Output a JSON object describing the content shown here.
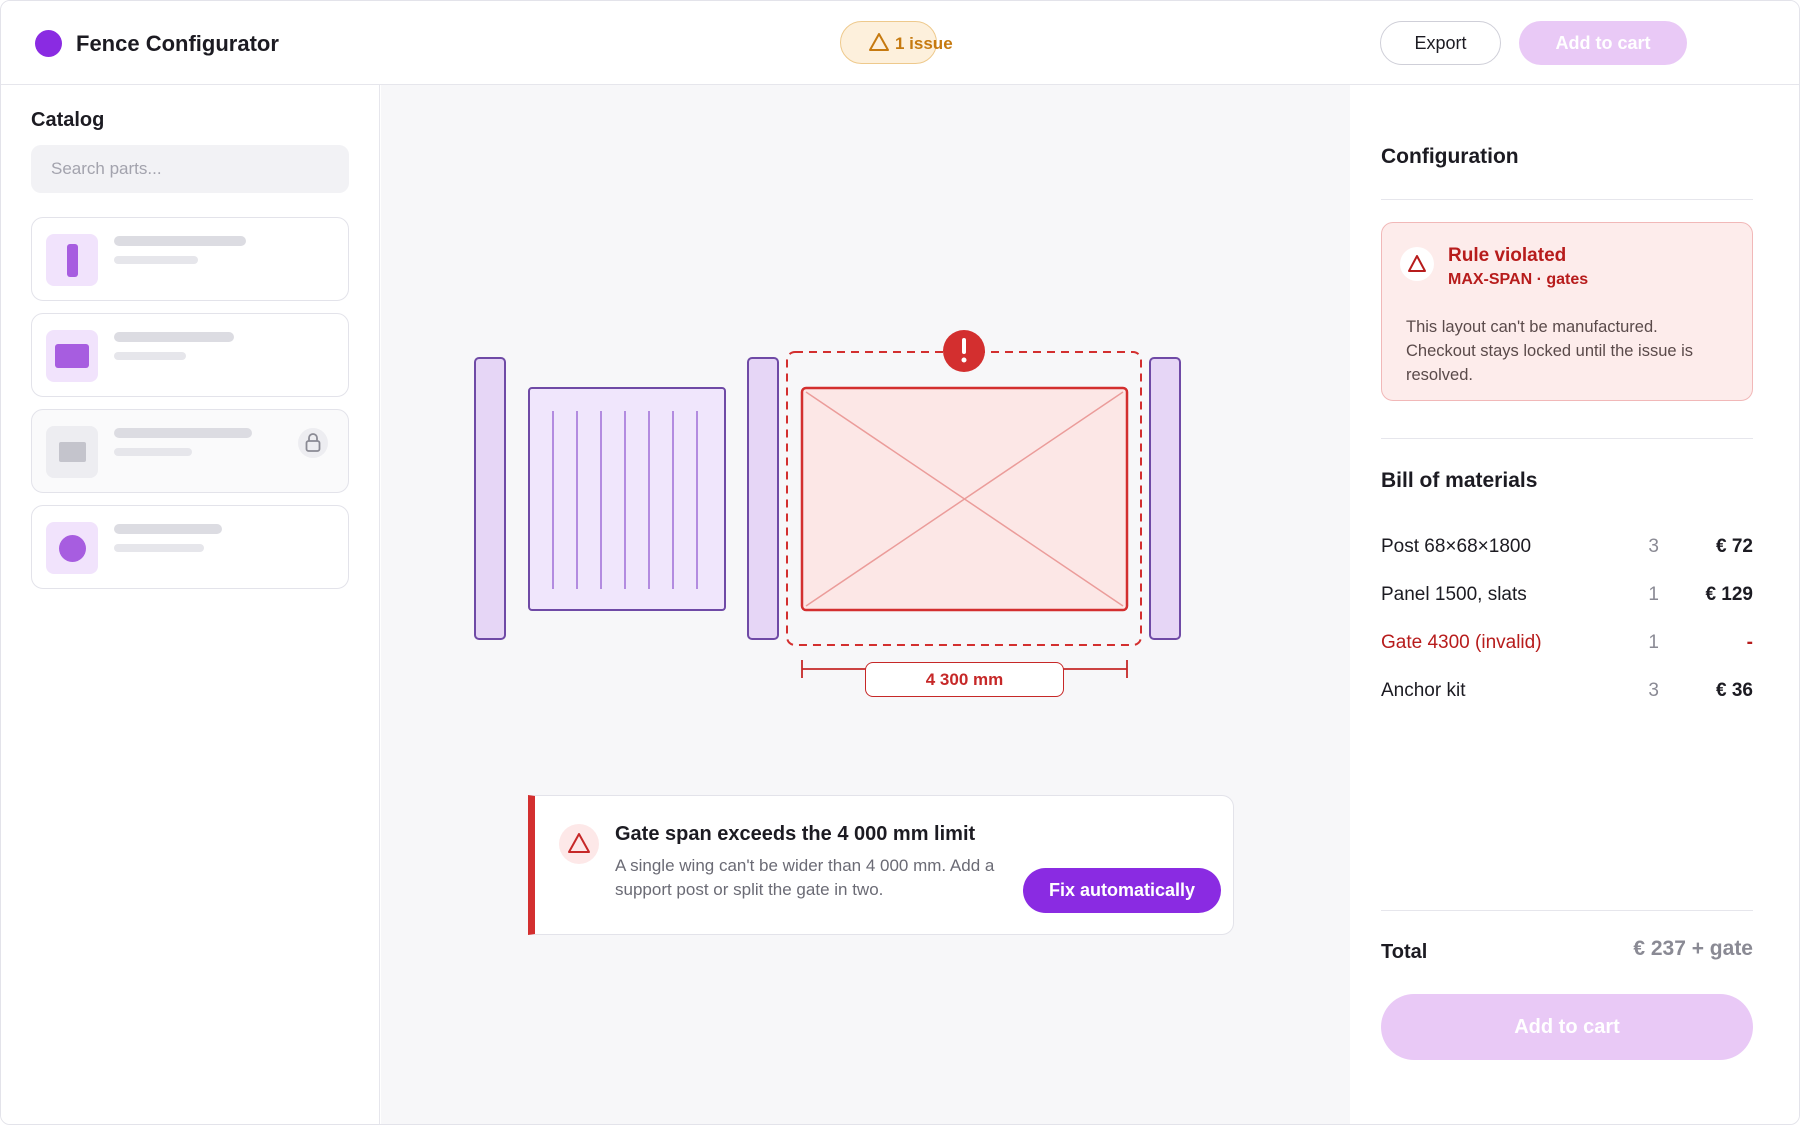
{
  "header": {
    "app_title": "Fence Configurator",
    "issue_badge": "1 issue",
    "export_label": "Export",
    "add_to_cart_label": "Add to cart"
  },
  "sidebar": {
    "title": "Catalog",
    "search_placeholder": "Search parts...",
    "items": [
      {
        "icon": "post-icon",
        "locked": false
      },
      {
        "icon": "panel-icon",
        "locked": false
      },
      {
        "icon": "panel-icon",
        "locked": true
      },
      {
        "icon": "circle-icon",
        "locked": false
      }
    ]
  },
  "canvas": {
    "dimension_label": "4 300 mm",
    "alert": {
      "title": "Gate span exceeds the 4 000 mm limit",
      "body": "A single wing can't be wider than 4 000 mm. Add a support post or split the gate in two.",
      "fix_label": "Fix automatically"
    }
  },
  "panel": {
    "config_title": "Configuration",
    "rule": {
      "title": "Rule violated",
      "code": "MAX-SPAN · gates",
      "description": "This layout can't be manufactured. Checkout stays locked until the issue is resolved."
    },
    "bom_title": "Bill of materials",
    "bom": [
      {
        "name": "Post 68×68×1800",
        "qty": "3",
        "price": "€ 72",
        "invalid": false
      },
      {
        "name": "Panel 1500, slats",
        "qty": "1",
        "price": "€ 129",
        "invalid": false
      },
      {
        "name": "Gate 4300 (invalid)",
        "qty": "1",
        "price": "-",
        "invalid": true
      },
      {
        "name": "Anchor kit",
        "qty": "3",
        "price": "€ 36",
        "invalid": false
      }
    ],
    "total_label": "Total",
    "total_value": "€ 237 + gate",
    "add_to_cart_label": "Add to cart"
  },
  "colors": {
    "accent": "#8a2be2",
    "error": "#d32f2f",
    "warning": "#c67a10"
  }
}
